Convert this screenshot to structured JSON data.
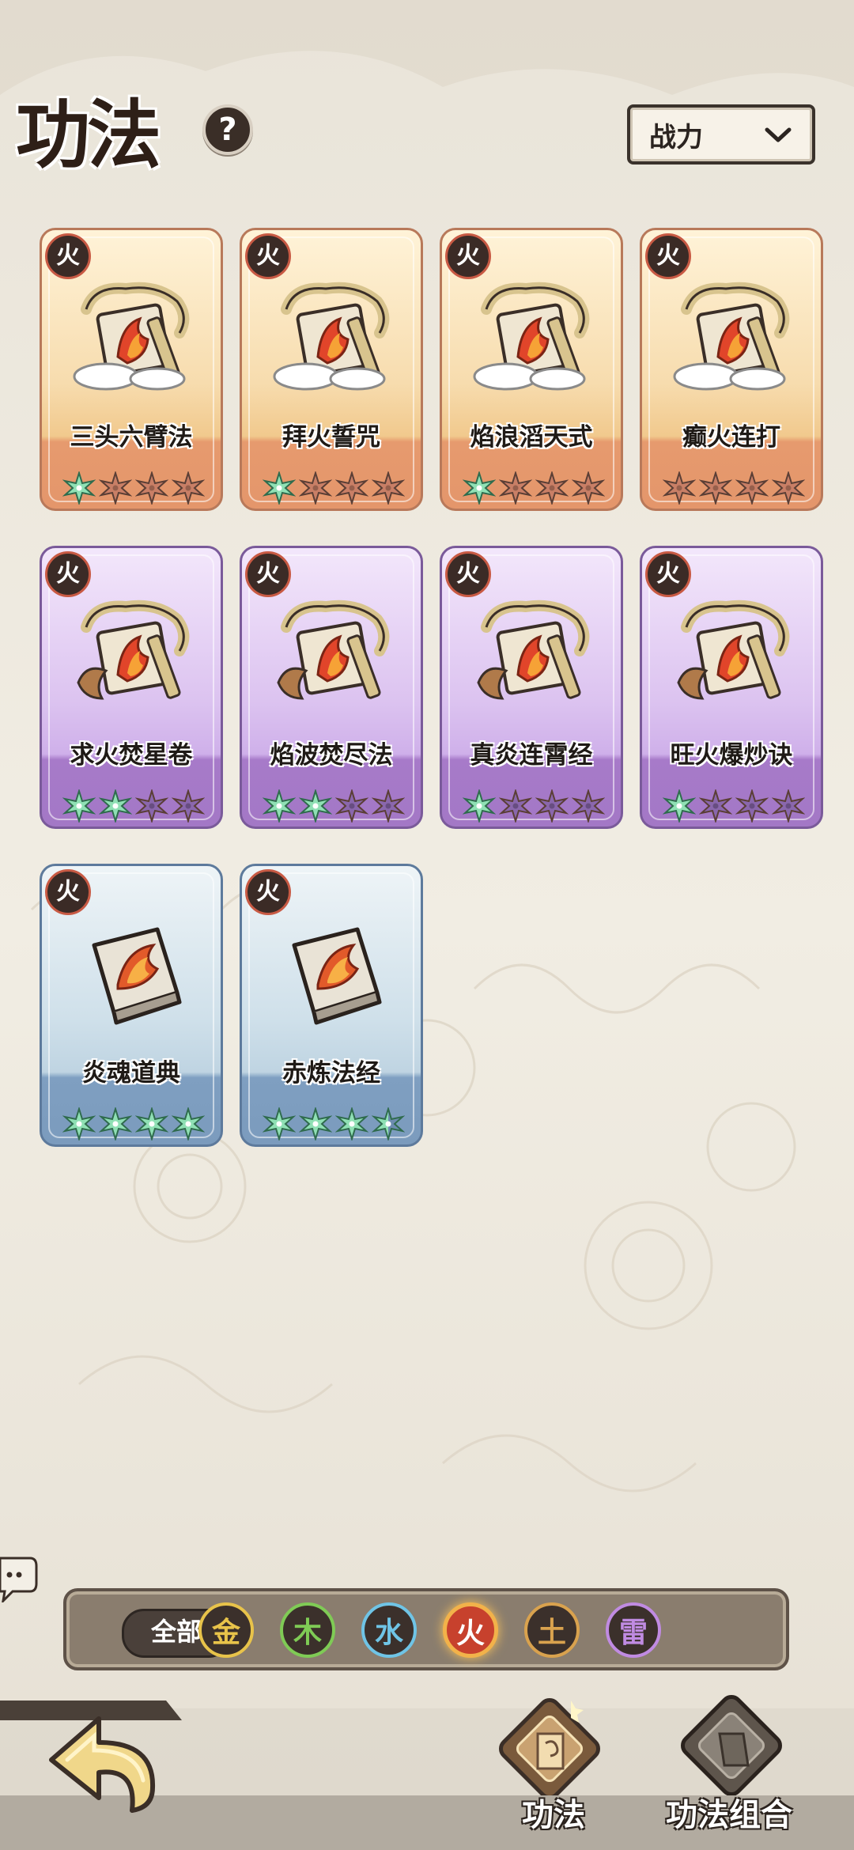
{
  "header": {
    "title": "功法",
    "help_label": "?",
    "sort_dropdown": {
      "selected": "战力"
    }
  },
  "cards": [
    {
      "name": "三头六臂法",
      "element": "火",
      "rarity": "orange",
      "stars_lit": 1,
      "stars_total": 4,
      "art": "fire-demon-dragon-scroll"
    },
    {
      "name": "拜火誓咒",
      "element": "火",
      "rarity": "orange",
      "stars_lit": 1,
      "stars_total": 4,
      "art": "fire-swirl-dragon-scroll"
    },
    {
      "name": "焰浪滔天式",
      "element": "火",
      "rarity": "orange",
      "stars_lit": 1,
      "stars_total": 4,
      "art": "fire-wave-dragon-scroll"
    },
    {
      "name": "癫火连打",
      "element": "火",
      "rarity": "orange",
      "stars_lit": 0,
      "stars_total": 4,
      "art": "fire-orb-dragon-scroll"
    },
    {
      "name": "求火焚星卷",
      "element": "火",
      "rarity": "purple",
      "stars_lit": 2,
      "stars_total": 4,
      "art": "fire-demon-phoenix-scroll"
    },
    {
      "name": "焰波焚尽法",
      "element": "火",
      "rarity": "purple",
      "stars_lit": 2,
      "stars_total": 4,
      "art": "fire-wave-phoenix-scroll"
    },
    {
      "name": "真炎连霄经",
      "element": "火",
      "rarity": "purple",
      "stars_lit": 1,
      "stars_total": 4,
      "art": "fire-slash-phoenix-scroll"
    },
    {
      "name": "旺火爆炒诀",
      "element": "火",
      "rarity": "purple",
      "stars_lit": 1,
      "stars_total": 4,
      "art": "fire-swirl-phoenix-scroll"
    },
    {
      "name": "炎魂道典",
      "element": "火",
      "rarity": "blue",
      "stars_lit": 4,
      "stars_total": 4,
      "art": "fire-book"
    },
    {
      "name": "赤炼法经",
      "element": "火",
      "rarity": "blue",
      "stars_lit": 3.5,
      "stars_total": 4,
      "art": "flame-claw-book"
    }
  ],
  "filter_bar": {
    "all_label": "全部",
    "elements": [
      {
        "label": "金",
        "color": "#e8c34a",
        "active": false
      },
      {
        "label": "木",
        "color": "#7fcb55",
        "active": false
      },
      {
        "label": "水",
        "color": "#6fc4e6",
        "active": false
      },
      {
        "label": "火",
        "color": "#e4553a",
        "active": true
      },
      {
        "label": "土",
        "color": "#d9a24e",
        "active": false
      },
      {
        "label": "雷",
        "color": "#c08be2",
        "active": false
      }
    ]
  },
  "bottom_nav": {
    "tab_gongfa": "功法",
    "tab_combo": "功法组合"
  },
  "colors": {
    "star_lit": "#8fe0b4",
    "star_dim_orange": "#c97f66",
    "star_dim_purple": "#8a67ad",
    "star_dim_blue": "#6d8cb0"
  }
}
